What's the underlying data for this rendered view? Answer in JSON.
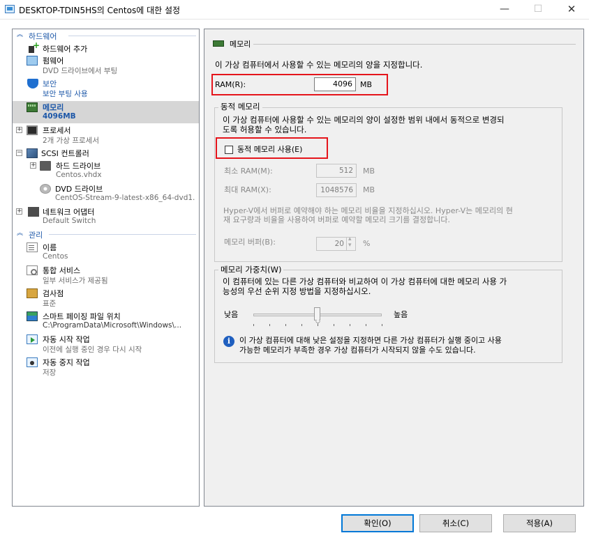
{
  "window": {
    "title": "DESKTOP-TDIN5HS의 Centos에 대한 설정",
    "minimize_glyph": "—",
    "maximize_glyph": "☐",
    "close_glyph": "✕"
  },
  "sidebar": {
    "hardware_header": "하드웨어",
    "management_header": "관리",
    "items": [
      {
        "main": "하드웨어 추가",
        "sub": "",
        "icon": "add-hardware-icon"
      },
      {
        "main": "펌웨어",
        "sub": "DVD 드라이브에서 부팅",
        "icon": "firmware-icon"
      },
      {
        "main": "보안",
        "sub": "보안 부팅 사용",
        "icon": "shield-icon"
      },
      {
        "main": "메모리",
        "sub": "4096MB",
        "icon": "memory-icon"
      },
      {
        "main": "프로세서",
        "sub": "2개 가상 프로세서",
        "icon": "processor-icon"
      },
      {
        "main": "SCSI 컨트롤러",
        "sub": "",
        "icon": "scsi-controller-icon"
      },
      {
        "main": "하드 드라이브",
        "sub": "Centos.vhdx",
        "icon": "hard-drive-icon"
      },
      {
        "main": "DVD 드라이브",
        "sub": "CentOS-Stream-9-latest-x86_64-dvd1...",
        "icon": "dvd-drive-icon"
      },
      {
        "main": "네트워크 어댑터",
        "sub": "Default Switch",
        "icon": "network-adapter-icon"
      },
      {
        "main": "이름",
        "sub": "Centos",
        "icon": "name-icon"
      },
      {
        "main": "통합 서비스",
        "sub": "일부 서비스가 제공됨",
        "icon": "integration-services-icon"
      },
      {
        "main": "검사점",
        "sub": "표준",
        "icon": "checkpoint-icon"
      },
      {
        "main": "스마트 페이징 파일 위치",
        "sub": "C:\\ProgramData\\Microsoft\\Windows\\...",
        "icon": "smart-paging-icon"
      },
      {
        "main": "자동 시작 작업",
        "sub": "이전에 실행 중인 경우 다시 시작",
        "icon": "auto-start-icon"
      },
      {
        "main": "자동 중지 작업",
        "sub": "저장",
        "icon": "auto-stop-icon"
      }
    ]
  },
  "memory": {
    "section_title": "메모리",
    "description": "이 가상 컴퓨터에서 사용할 수 있는 메모리의 양을 지정합니다.",
    "ram_label": "RAM(R):",
    "ram_value": "4096",
    "ram_unit": "MB",
    "dynamic": {
      "title": "동적 메모리",
      "description_line1": "이 가상 컴퓨터에 사용할 수 있는 메모리의 양이 설정한 범위 내에서 동적으로 변경되",
      "description_line2": "도록 허용할 수 있습니다.",
      "enable_label": "동적 메모리 사용(E)",
      "enabled": false,
      "min_label": "최소 RAM(M):",
      "min_value": "512",
      "min_unit": "MB",
      "max_label": "최대 RAM(X):",
      "max_value": "1048576",
      "max_unit": "MB",
      "buffer_desc_line1": "Hyper-V에서 버퍼로 예약해야 하는 메모리 비율을 지정하십시오. Hyper-V는 메모리의 현",
      "buffer_desc_line2": "재 요구량과 비율을 사용하여 버퍼로 예약할 메모리 크기를 결정합니다.",
      "buffer_label": "메모리 버퍼(B):",
      "buffer_value": "20",
      "buffer_unit": "%"
    },
    "weight": {
      "title": "메모리 가중치(W)",
      "description_line1": "이 컴퓨터에 있는 다른 가상 컴퓨터와 비교하여 이 가상 컴퓨터에 대한 메모리 사용 가",
      "description_line2": "능성의 우선 순위 지정 방법을 지정하십시오.",
      "low_label": "낮음",
      "high_label": "높음",
      "slider_level": 0.5,
      "info_line1": "이 가상 컴퓨터에 대해 낮은 설정을 지정하면 다른 가상 컴퓨터가 실행 중이고 사용",
      "info_line2": "가능한 메모리가 부족한 경우 가상 컴퓨터가 시작되지 않을 수도 있습니다."
    }
  },
  "footer": {
    "ok": "확인(O)",
    "cancel": "취소(C)",
    "apply": "적용(A)"
  }
}
